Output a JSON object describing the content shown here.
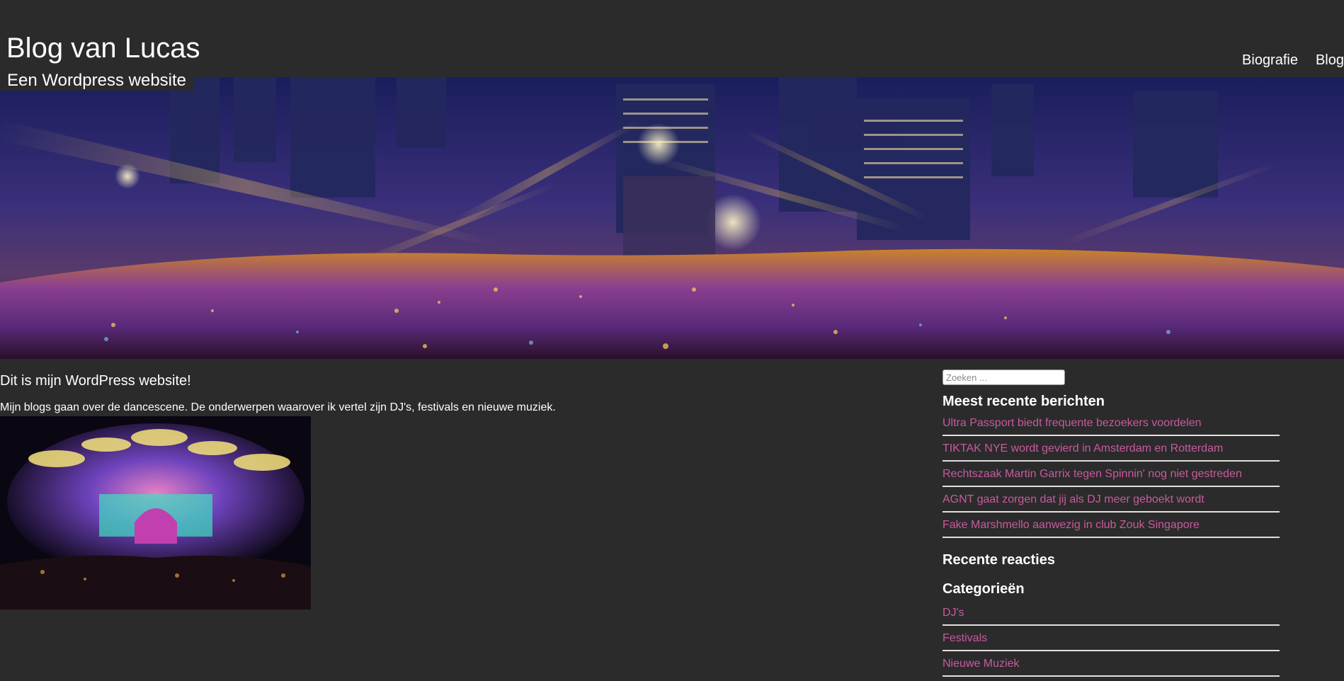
{
  "header": {
    "site_title": "Blog van Lucas",
    "tagline": "Een Wordpress website",
    "nav": [
      {
        "label": "Biografie"
      },
      {
        "label": "Blog"
      }
    ]
  },
  "post": {
    "title": "Dit is mijn WordPress website!",
    "text": "Mijn blogs gaan over de dancescene. De onderwerpen waarover ik vertel zijn DJ's, festivals en nieuwe muziek."
  },
  "sidebar": {
    "search": {
      "placeholder": "Zoeken ..."
    },
    "recent_posts": {
      "title": "Meest recente berichten",
      "items": [
        {
          "label": "Ultra Passport biedt frequente bezoekers voordelen"
        },
        {
          "label": "TIKTAK NYE wordt gevierd in Amsterdam en Rotterdam"
        },
        {
          "label": "Rechtszaak Martin Garrix tegen Spinnin' nog niet gestreden"
        },
        {
          "label": "AGNT gaat zorgen dat jij als DJ meer geboekt wordt"
        },
        {
          "label": "Fake Marshmello aanwezig in club Zouk Singapore"
        }
      ]
    },
    "recent_comments": {
      "title": "Recente reacties"
    },
    "categories": {
      "title": "Categorieën",
      "items": [
        {
          "label": "DJ's"
        },
        {
          "label": "Festivals"
        },
        {
          "label": "Nieuwe Muziek"
        }
      ]
    }
  },
  "colors": {
    "background": "#2b2b2b",
    "link": "#c85a9e",
    "divider": "#e0e0e0"
  }
}
